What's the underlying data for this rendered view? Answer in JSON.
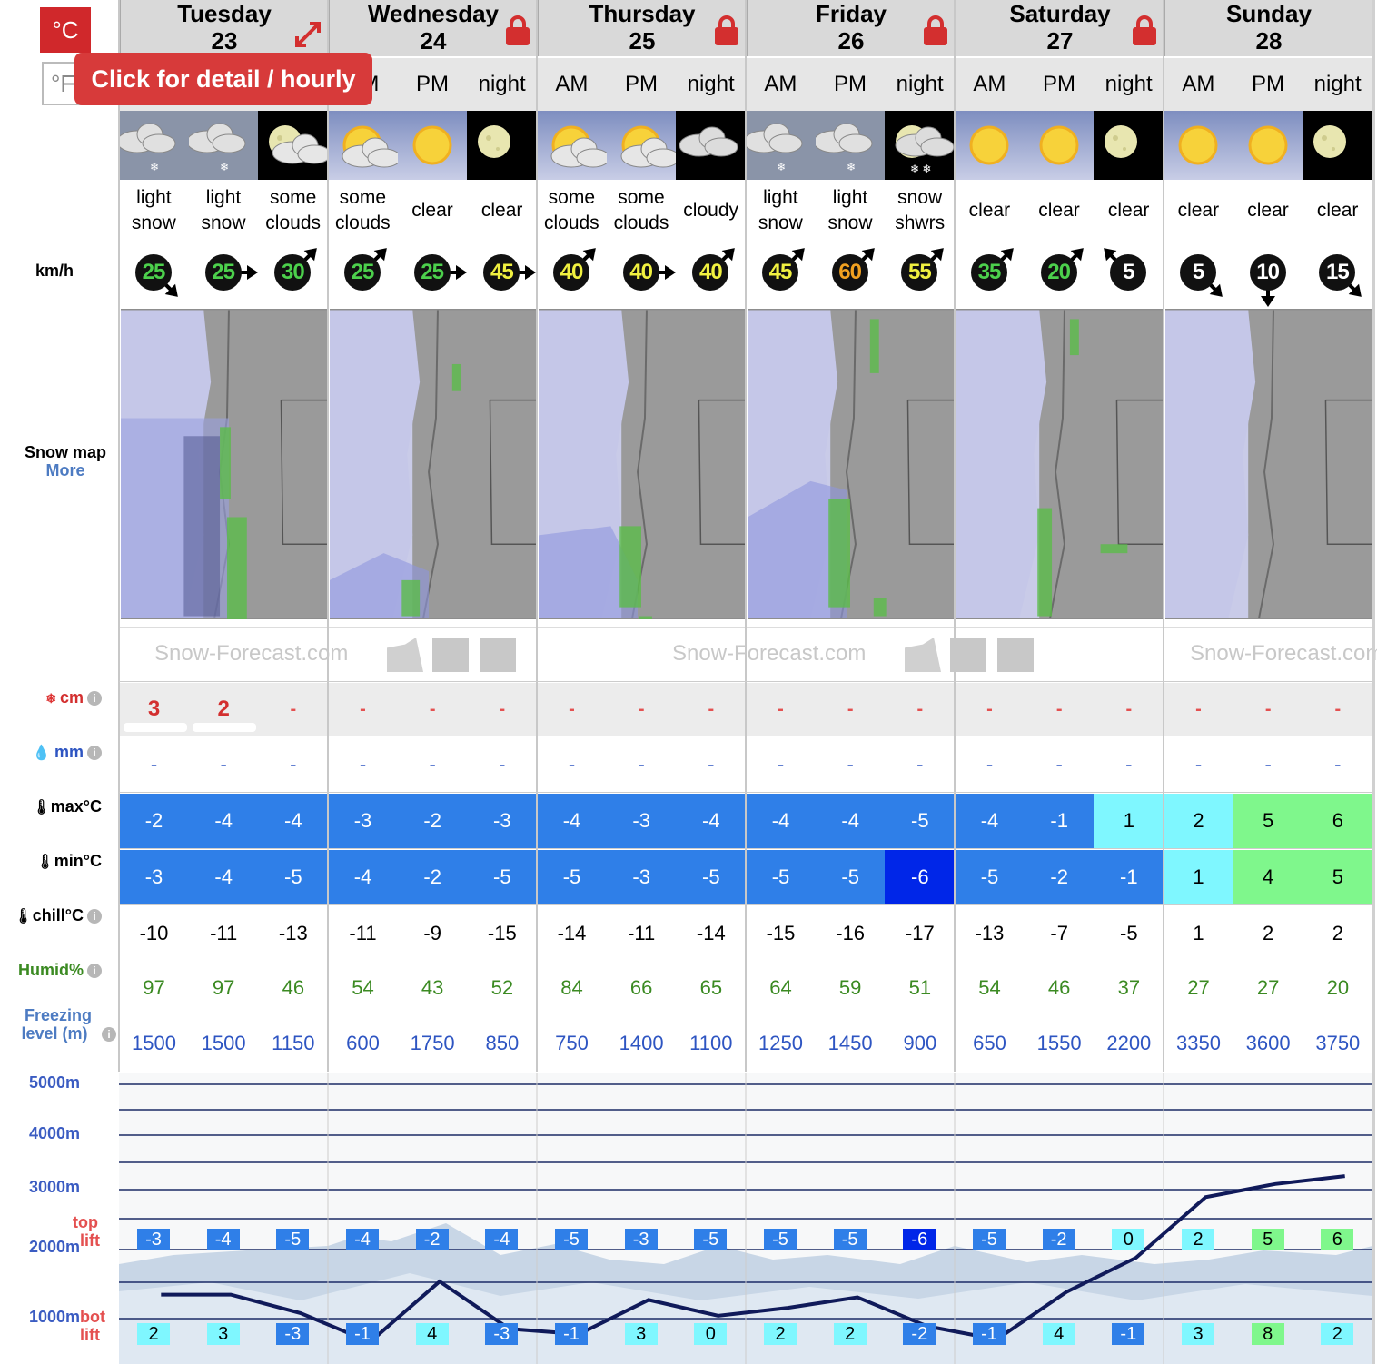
{
  "units": {
    "c_button": "°C",
    "f_button": "°F",
    "tooltip": "Click for detail / hourly"
  },
  "row_labels": {
    "wind": "km/h",
    "snow_map": "Snow map",
    "more": "More",
    "snow": "cm",
    "rain": "mm",
    "max": "max°C",
    "min": "min°C",
    "chill": "chill°C",
    "humid": "Humid%",
    "freezing": "Freezing",
    "freezing2": "level (m)",
    "info": "i"
  },
  "scale": {
    "5000": "5000m",
    "4000": "4000m",
    "3000": "3000m",
    "2000": "2000m",
    "1000": "1000m",
    "top": "top",
    "top2": "lift",
    "bot": "bot",
    "bot2": "lift"
  },
  "days": [
    {
      "name": "Tuesday",
      "date": "23",
      "locked": false
    },
    {
      "name": "Wednesday",
      "date": "24",
      "locked": true
    },
    {
      "name": "Thursday",
      "date": "25",
      "locked": true
    },
    {
      "name": "Friday",
      "date": "26",
      "locked": true
    },
    {
      "name": "Saturday",
      "date": "27",
      "locked": true
    },
    {
      "name": "Sunday",
      "date": "28",
      "locked": false
    }
  ],
  "periods": [
    "AM",
    "PM",
    "night",
    "AM",
    "PM",
    "night",
    "AM",
    "PM",
    "night",
    "AM",
    "PM",
    "night",
    "AM",
    "PM",
    "night",
    "AM",
    "PM",
    "night"
  ],
  "weather": [
    {
      "icon": "snow-cloud-icon",
      "l1": "light",
      "l2": "snow"
    },
    {
      "icon": "snow-cloud-icon",
      "l1": "light",
      "l2": "snow"
    },
    {
      "icon": "moon-cloud-icon",
      "l1": "some",
      "l2": "clouds"
    },
    {
      "icon": "sun-cloud-icon",
      "l1": "some",
      "l2": "clouds"
    },
    {
      "icon": "sun-icon",
      "l1": "clear",
      "l2": ""
    },
    {
      "icon": "moon-icon",
      "l1": "clear",
      "l2": ""
    },
    {
      "icon": "sun-cloud-icon",
      "l1": "some",
      "l2": "clouds"
    },
    {
      "icon": "sun-cloud-icon",
      "l1": "some",
      "l2": "clouds"
    },
    {
      "icon": "night-cloud-icon",
      "l1": "cloudy",
      "l2": ""
    },
    {
      "icon": "snow-cloud-icon",
      "l1": "light",
      "l2": "snow"
    },
    {
      "icon": "snow-cloud-icon",
      "l1": "light",
      "l2": "snow"
    },
    {
      "icon": "moon-snow-icon",
      "l1": "snow",
      "l2": "shwrs"
    },
    {
      "icon": "sun-icon",
      "l1": "clear",
      "l2": ""
    },
    {
      "icon": "sun-icon",
      "l1": "clear",
      "l2": ""
    },
    {
      "icon": "moon-icon",
      "l1": "clear",
      "l2": ""
    },
    {
      "icon": "sun-icon",
      "l1": "clear",
      "l2": ""
    },
    {
      "icon": "sun-icon",
      "l1": "clear",
      "l2": ""
    },
    {
      "icon": "moon-icon",
      "l1": "clear",
      "l2": ""
    }
  ],
  "wind": [
    {
      "v": "25",
      "col": "#4cd04c",
      "dir": "se"
    },
    {
      "v": "25",
      "col": "#4cd04c",
      "dir": "e"
    },
    {
      "v": "30",
      "col": "#4cd04c",
      "dir": "ne"
    },
    {
      "v": "25",
      "col": "#4cd04c",
      "dir": "ne"
    },
    {
      "v": "25",
      "col": "#4cd04c",
      "dir": "e"
    },
    {
      "v": "45",
      "col": "#f0f040",
      "dir": "e"
    },
    {
      "v": "40",
      "col": "#f0f040",
      "dir": "ne"
    },
    {
      "v": "40",
      "col": "#f0f040",
      "dir": "e"
    },
    {
      "v": "40",
      "col": "#f0f040",
      "dir": "ne"
    },
    {
      "v": "45",
      "col": "#f0f040",
      "dir": "ne"
    },
    {
      "v": "60",
      "col": "#f0a020",
      "dir": "ne"
    },
    {
      "v": "55",
      "col": "#f0f040",
      "dir": "ne"
    },
    {
      "v": "35",
      "col": "#4cd04c",
      "dir": "ne"
    },
    {
      "v": "20",
      "col": "#4cd04c",
      "dir": "ne"
    },
    {
      "v": "5",
      "col": "#ffffff",
      "dir": "nw"
    },
    {
      "v": "5",
      "col": "#ffffff",
      "dir": "se"
    },
    {
      "v": "10",
      "col": "#ffffff",
      "dir": "s"
    },
    {
      "v": "15",
      "col": "#ffffff",
      "dir": "se"
    }
  ],
  "watermark": {
    "text": "Snow-Forecast.com"
  },
  "snow": [
    "3",
    "2",
    "-",
    "-",
    "-",
    "-",
    "-",
    "-",
    "-",
    "-",
    "-",
    "-",
    "-",
    "-",
    "-",
    "-",
    "-",
    "-"
  ],
  "rain": [
    "-",
    "-",
    "-",
    "-",
    "-",
    "-",
    "-",
    "-",
    "-",
    "-",
    "-",
    "-",
    "-",
    "-",
    "-",
    "-",
    "-",
    "-"
  ],
  "max": [
    "-2",
    "-4",
    "-4",
    "-3",
    "-2",
    "-3",
    "-4",
    "-3",
    "-4",
    "-4",
    "-4",
    "-5",
    "-4",
    "-1",
    "1",
    "2",
    "5",
    "6"
  ],
  "min": [
    "-3",
    "-4",
    "-5",
    "-4",
    "-2",
    "-5",
    "-5",
    "-3",
    "-5",
    "-5",
    "-5",
    "-6",
    "-5",
    "-2",
    "-1",
    "1",
    "4",
    "5"
  ],
  "chill": [
    "-10",
    "-11",
    "-13",
    "-11",
    "-9",
    "-15",
    "-14",
    "-11",
    "-14",
    "-15",
    "-16",
    "-17",
    "-13",
    "-7",
    "-5",
    "1",
    "2",
    "2"
  ],
  "humid": [
    "97",
    "97",
    "46",
    "54",
    "43",
    "52",
    "84",
    "66",
    "65",
    "64",
    "59",
    "51",
    "54",
    "46",
    "37",
    "27",
    "27",
    "20"
  ],
  "freezing": [
    "1500",
    "1500",
    "1150",
    "600",
    "1750",
    "850",
    "750",
    "1400",
    "1100",
    "1250",
    "1450",
    "900",
    "650",
    "1550",
    "2200",
    "3350",
    "3600",
    "3750"
  ],
  "toplift": [
    "-3",
    "-4",
    "-5",
    "-4",
    "-2",
    "-4",
    "-5",
    "-3",
    "-5",
    "-5",
    "-5",
    "-6",
    "-5",
    "-2",
    "0",
    "2",
    "5",
    "6"
  ],
  "botlift": [
    "2",
    "3",
    "-3",
    "-1",
    "4",
    "-3",
    "-1",
    "3",
    "0",
    "2",
    "2",
    "-2",
    "-1",
    "4",
    "-1",
    "3",
    "8",
    "2"
  ],
  "colors": {
    "blue": "#2f7fe8",
    "darkblue": "#0026e8",
    "cyan": "#7ff7ff",
    "green": "#7ff78c",
    "lightgreen": "#b8f7b0",
    "red": "#d32f2f"
  }
}
